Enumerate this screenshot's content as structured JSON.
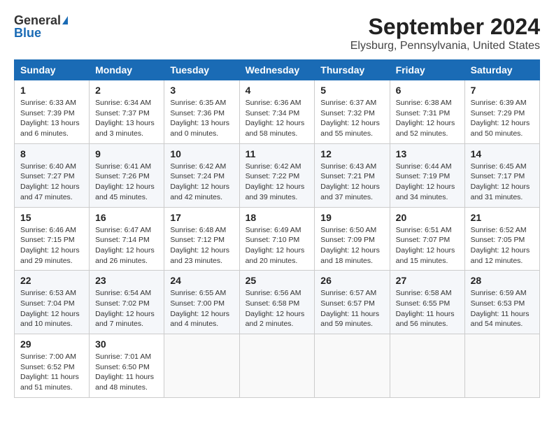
{
  "header": {
    "logo_general": "General",
    "logo_blue": "Blue",
    "title": "September 2024",
    "subtitle": "Elysburg, Pennsylvania, United States"
  },
  "days_of_week": [
    "Sunday",
    "Monday",
    "Tuesday",
    "Wednesday",
    "Thursday",
    "Friday",
    "Saturday"
  ],
  "weeks": [
    [
      {
        "day": "1",
        "text": "Sunrise: 6:33 AM\nSunset: 7:39 PM\nDaylight: 13 hours\nand 6 minutes."
      },
      {
        "day": "2",
        "text": "Sunrise: 6:34 AM\nSunset: 7:37 PM\nDaylight: 13 hours\nand 3 minutes."
      },
      {
        "day": "3",
        "text": "Sunrise: 6:35 AM\nSunset: 7:36 PM\nDaylight: 13 hours\nand 0 minutes."
      },
      {
        "day": "4",
        "text": "Sunrise: 6:36 AM\nSunset: 7:34 PM\nDaylight: 12 hours\nand 58 minutes."
      },
      {
        "day": "5",
        "text": "Sunrise: 6:37 AM\nSunset: 7:32 PM\nDaylight: 12 hours\nand 55 minutes."
      },
      {
        "day": "6",
        "text": "Sunrise: 6:38 AM\nSunset: 7:31 PM\nDaylight: 12 hours\nand 52 minutes."
      },
      {
        "day": "7",
        "text": "Sunrise: 6:39 AM\nSunset: 7:29 PM\nDaylight: 12 hours\nand 50 minutes."
      }
    ],
    [
      {
        "day": "8",
        "text": "Sunrise: 6:40 AM\nSunset: 7:27 PM\nDaylight: 12 hours\nand 47 minutes."
      },
      {
        "day": "9",
        "text": "Sunrise: 6:41 AM\nSunset: 7:26 PM\nDaylight: 12 hours\nand 45 minutes."
      },
      {
        "day": "10",
        "text": "Sunrise: 6:42 AM\nSunset: 7:24 PM\nDaylight: 12 hours\nand 42 minutes."
      },
      {
        "day": "11",
        "text": "Sunrise: 6:42 AM\nSunset: 7:22 PM\nDaylight: 12 hours\nand 39 minutes."
      },
      {
        "day": "12",
        "text": "Sunrise: 6:43 AM\nSunset: 7:21 PM\nDaylight: 12 hours\nand 37 minutes."
      },
      {
        "day": "13",
        "text": "Sunrise: 6:44 AM\nSunset: 7:19 PM\nDaylight: 12 hours\nand 34 minutes."
      },
      {
        "day": "14",
        "text": "Sunrise: 6:45 AM\nSunset: 7:17 PM\nDaylight: 12 hours\nand 31 minutes."
      }
    ],
    [
      {
        "day": "15",
        "text": "Sunrise: 6:46 AM\nSunset: 7:15 PM\nDaylight: 12 hours\nand 29 minutes."
      },
      {
        "day": "16",
        "text": "Sunrise: 6:47 AM\nSunset: 7:14 PM\nDaylight: 12 hours\nand 26 minutes."
      },
      {
        "day": "17",
        "text": "Sunrise: 6:48 AM\nSunset: 7:12 PM\nDaylight: 12 hours\nand 23 minutes."
      },
      {
        "day": "18",
        "text": "Sunrise: 6:49 AM\nSunset: 7:10 PM\nDaylight: 12 hours\nand 20 minutes."
      },
      {
        "day": "19",
        "text": "Sunrise: 6:50 AM\nSunset: 7:09 PM\nDaylight: 12 hours\nand 18 minutes."
      },
      {
        "day": "20",
        "text": "Sunrise: 6:51 AM\nSunset: 7:07 PM\nDaylight: 12 hours\nand 15 minutes."
      },
      {
        "day": "21",
        "text": "Sunrise: 6:52 AM\nSunset: 7:05 PM\nDaylight: 12 hours\nand 12 minutes."
      }
    ],
    [
      {
        "day": "22",
        "text": "Sunrise: 6:53 AM\nSunset: 7:04 PM\nDaylight: 12 hours\nand 10 minutes."
      },
      {
        "day": "23",
        "text": "Sunrise: 6:54 AM\nSunset: 7:02 PM\nDaylight: 12 hours\nand 7 minutes."
      },
      {
        "day": "24",
        "text": "Sunrise: 6:55 AM\nSunset: 7:00 PM\nDaylight: 12 hours\nand 4 minutes."
      },
      {
        "day": "25",
        "text": "Sunrise: 6:56 AM\nSunset: 6:58 PM\nDaylight: 12 hours\nand 2 minutes."
      },
      {
        "day": "26",
        "text": "Sunrise: 6:57 AM\nSunset: 6:57 PM\nDaylight: 11 hours\nand 59 minutes."
      },
      {
        "day": "27",
        "text": "Sunrise: 6:58 AM\nSunset: 6:55 PM\nDaylight: 11 hours\nand 56 minutes."
      },
      {
        "day": "28",
        "text": "Sunrise: 6:59 AM\nSunset: 6:53 PM\nDaylight: 11 hours\nand 54 minutes."
      }
    ],
    [
      {
        "day": "29",
        "text": "Sunrise: 7:00 AM\nSunset: 6:52 PM\nDaylight: 11 hours\nand 51 minutes."
      },
      {
        "day": "30",
        "text": "Sunrise: 7:01 AM\nSunset: 6:50 PM\nDaylight: 11 hours\nand 48 minutes."
      },
      {
        "day": "",
        "text": ""
      },
      {
        "day": "",
        "text": ""
      },
      {
        "day": "",
        "text": ""
      },
      {
        "day": "",
        "text": ""
      },
      {
        "day": "",
        "text": ""
      }
    ]
  ]
}
